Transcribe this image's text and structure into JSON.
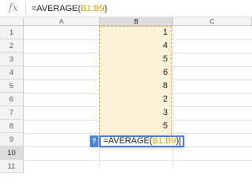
{
  "formula_bar": {
    "fx_label": "fx",
    "prefix": "=AVERAGE(",
    "range": "B1:B9",
    "suffix": ")"
  },
  "columns": [
    "A",
    "B",
    "C"
  ],
  "rows": [
    "1",
    "2",
    "3",
    "4",
    "5",
    "6",
    "7",
    "8",
    "9",
    "10",
    "11"
  ],
  "column_b_values": [
    "1",
    "4",
    "5",
    "6",
    "8",
    "2",
    "3",
    "5",
    "6"
  ],
  "editor": {
    "prefix": "=AVERAGE(",
    "range": "B1:B9",
    "suffix": ")"
  },
  "help_icon": "?",
  "colors": {
    "range_highlight": "#fdf1d8",
    "range_border": "#e8a63b",
    "range_text": "#e0a000",
    "active_border": "#4a7fd4"
  }
}
